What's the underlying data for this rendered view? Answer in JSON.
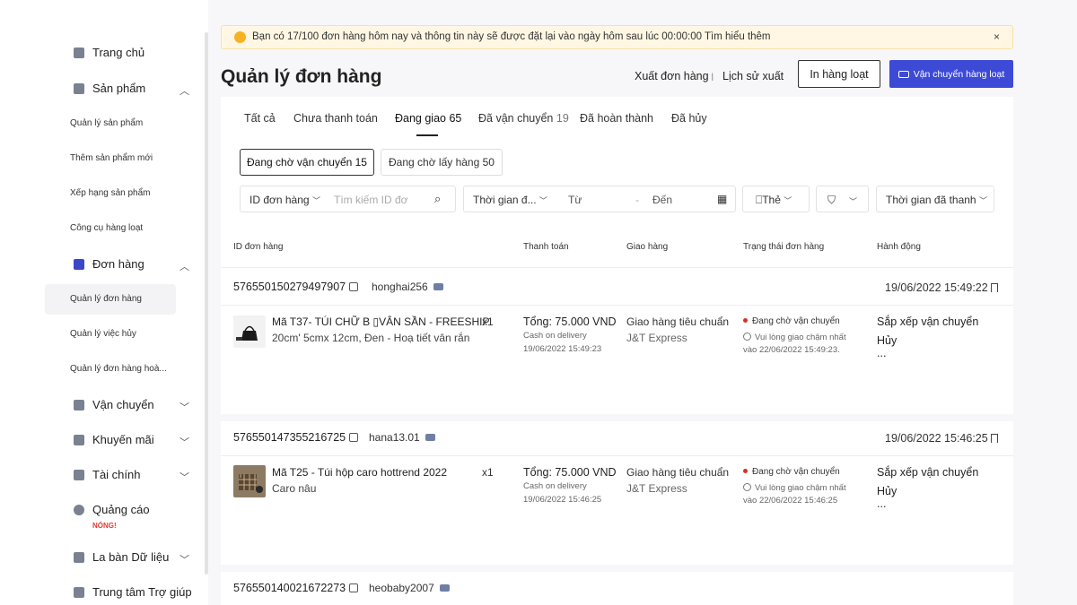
{
  "sidebar": {
    "home": "Trang chủ",
    "products": "Sản phẩm",
    "product_items": [
      "Quản lý sản phẩm",
      "Thêm sản phẩm mới",
      "Xếp hạng sản phẩm",
      "Công cụ hàng loạt"
    ],
    "orders": "Đơn hàng",
    "order_items": [
      "Quản lý đơn hàng",
      "Quản lý việc hủy",
      "Quản lý đơn hàng hoà..."
    ],
    "shipping": "Vận chuyển",
    "promotions": "Khuyến mãi",
    "finance": "Tài chính",
    "ads": "Quảng cáo",
    "ads_badge": "NÓNG!",
    "data_compass": "La bàn Dữ liệu",
    "help_center": "Trung tâm Trợ giúp"
  },
  "notice": {
    "text": "Bạn có 17/100 đơn hàng hôm nay và thông tin này sẽ được đặt lại vào ngày hôm sau lúc 00:00:00",
    "link": "Tìm hiểu thêm",
    "close": "×"
  },
  "header": {
    "title": "Quản lý đơn hàng",
    "export": "Xuất đơn hàng",
    "separator": "I",
    "export_history": "Lịch sử xuất",
    "print_bulk": "In hàng loạt",
    "ship_bulk": "Vận chuyển hàng loạt"
  },
  "tabs": [
    {
      "label": "Tất cả",
      "count": ""
    },
    {
      "label": "Chưa thanh toán",
      "count": ""
    },
    {
      "label": "Đang giao",
      "count": "65"
    },
    {
      "label": "Đã vận chuyển",
      "count": "19"
    },
    {
      "label": "Đã hoàn thành",
      "count": ""
    },
    {
      "label": "Đã hủy",
      "count": ""
    }
  ],
  "subtabs": [
    "Đang chờ vận chuyển 15",
    "Đang chờ lấy hàng 50"
  ],
  "filters": {
    "id_type": "ID đơn hàng",
    "search_placeholder": "Tìm kiếm ID đơ",
    "time_type": "Thời gian đ...",
    "from": "Từ",
    "dash": "-",
    "to": "Đến",
    "tag": "Thẻ",
    "paid_time": "Thời gian đã thanh"
  },
  "columns": [
    "ID đơn hàng",
    "Thanh toán",
    "Giao hàng",
    "Trạng thái đơn hàng",
    "Hành động"
  ],
  "orders": [
    {
      "id": "576550150279497907",
      "buyer": "honghai256",
      "time": "19/06/2022 15:49:22",
      "product": "Mã T37- TÚI CHỮ B ▯VÂN SẦN - FREESHIP",
      "variant": "20cm' 5cmx 12cm, Đen - Hoạ tiết vân rắn",
      "qty": "x1",
      "total": "Tổng: 75.000 VND",
      "payment": "Cash on delivery",
      "pay_time": "19/06/2022 15:49:23",
      "shipping": "Giao hàng tiêu chuẩn",
      "carrier": "J&T Express",
      "status": "Đang chờ vận chuyển",
      "hint1": "Vui lòng giao chậm nhất",
      "hint2": "vào 22/06/2022 15:49:23.",
      "action1": "Sắp xếp vận chuyển",
      "action2": "Hủy",
      "more": "..."
    },
    {
      "id": "576550147355216725",
      "buyer": "hana13.01",
      "time": "19/06/2022 15:46:25",
      "product": "Mã T25 - Túi hộp caro hottrend 2022",
      "variant": "Caro nâu",
      "qty": "x1",
      "total": "Tổng: 75.000 VND",
      "payment": "Cash on delivery",
      "pay_time": "19/06/2022 15:46:25",
      "shipping": "Giao hàng tiêu chuẩn",
      "carrier": "J&T Express",
      "status": "Đang chờ vận chuyển",
      "hint1": "Vui lòng giao chậm nhất",
      "hint2": "vào 22/06/2022 15:46:25",
      "action1": "Sắp xếp vận chuyển",
      "action2": "Hủy",
      "more": "..."
    },
    {
      "id": "576550140021672273",
      "buyer": "heobaby2007"
    }
  ]
}
